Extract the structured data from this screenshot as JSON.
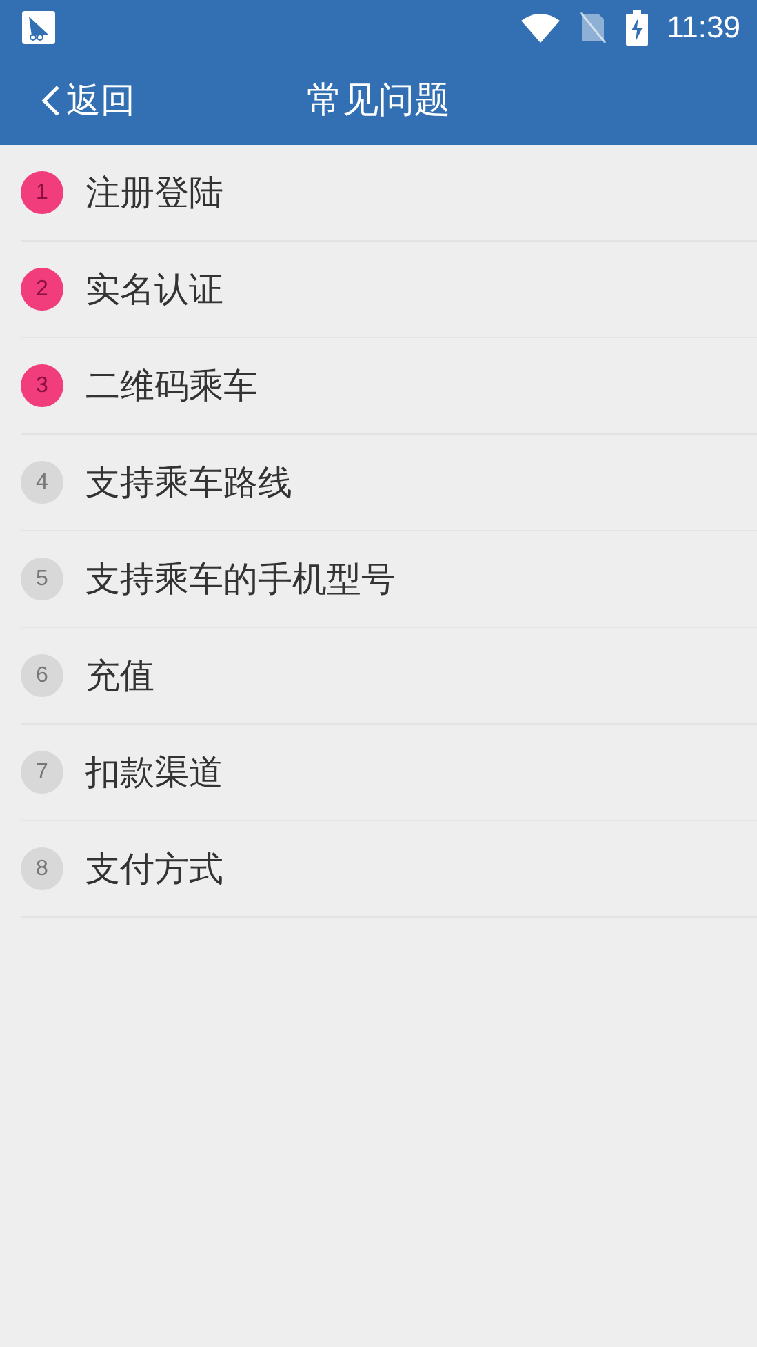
{
  "status_bar": {
    "time": "11:39"
  },
  "header": {
    "back": "返回",
    "title": "常见问题"
  },
  "items": [
    {
      "number": "1",
      "label": "注册登陆",
      "highlighted": true
    },
    {
      "number": "2",
      "label": "实名认证",
      "highlighted": true
    },
    {
      "number": "3",
      "label": "二维码乘车",
      "highlighted": true
    },
    {
      "number": "4",
      "label": "支持乘车路线",
      "highlighted": false
    },
    {
      "number": "5",
      "label": "支持乘车的手机型号",
      "highlighted": false
    },
    {
      "number": "6",
      "label": "充值",
      "highlighted": false
    },
    {
      "number": "7",
      "label": "扣款渠道",
      "highlighted": false
    },
    {
      "number": "8",
      "label": "支付方式",
      "highlighted": false
    }
  ]
}
